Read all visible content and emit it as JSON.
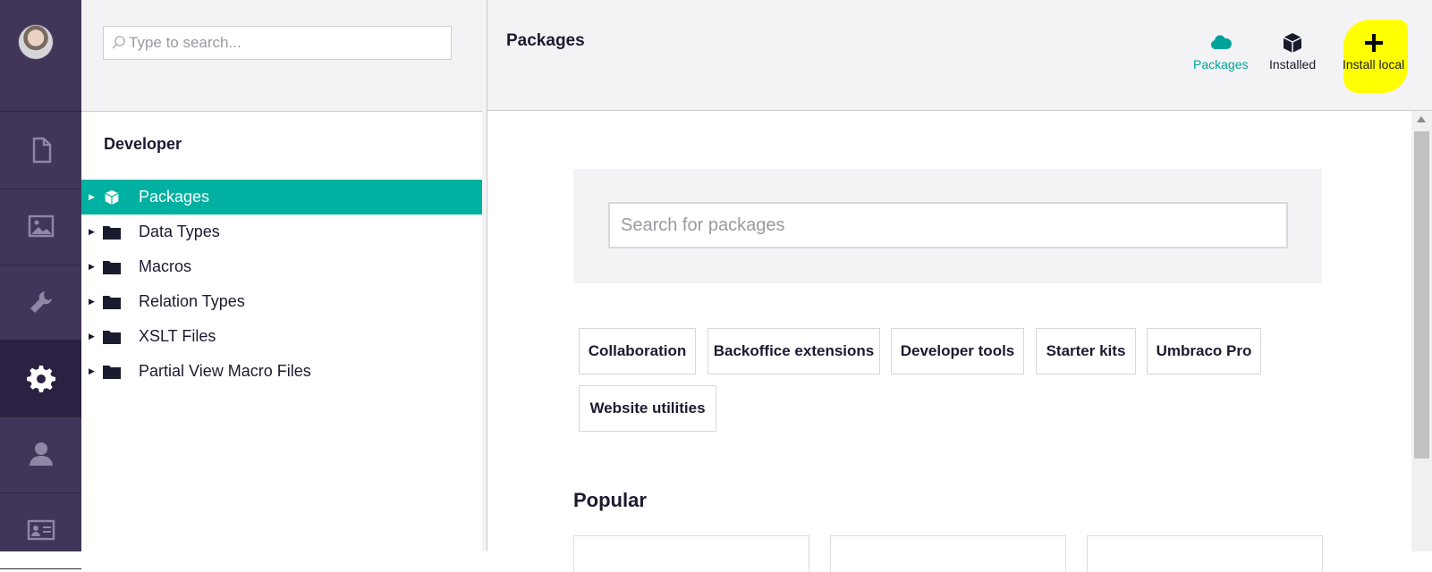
{
  "nav": {
    "sections": [
      {
        "icon": "document-icon",
        "name": "content"
      },
      {
        "icon": "image-icon",
        "name": "media"
      },
      {
        "icon": "wrench-icon",
        "name": "settings"
      },
      {
        "icon": "gear-icon",
        "name": "developer",
        "active": true
      },
      {
        "icon": "user-icon",
        "name": "users"
      },
      {
        "icon": "contact-card-icon",
        "name": "members"
      }
    ]
  },
  "tree": {
    "search_placeholder": "Type to search...",
    "title": "Developer",
    "items": [
      {
        "label": "Packages",
        "icon": "package-icon",
        "active": true
      },
      {
        "label": "Data Types",
        "icon": "folder-icon"
      },
      {
        "label": "Macros",
        "icon": "folder-icon"
      },
      {
        "label": "Relation Types",
        "icon": "folder-icon"
      },
      {
        "label": "XSLT Files",
        "icon": "folder-icon"
      },
      {
        "label": "Partial View Macro Files",
        "icon": "folder-icon"
      }
    ]
  },
  "editor": {
    "title": "Packages",
    "header_buttons": [
      {
        "label": "Packages",
        "icon": "cloud-icon",
        "active": true
      },
      {
        "label": "Installed",
        "icon": "box-icon"
      },
      {
        "label": "Install local",
        "icon": "plus-icon"
      }
    ],
    "search_placeholder": "Search for packages",
    "categories": [
      "Collaboration",
      "Backoffice extensions",
      "Developer tools",
      "Starter kits",
      "Umbraco Pro",
      "Website utilities"
    ],
    "popular_heading": "Popular"
  },
  "colors": {
    "nav_bg": "#413659",
    "nav_active": "#2c2142",
    "accent": "#00b0a0",
    "highlight": "#ffff00"
  }
}
